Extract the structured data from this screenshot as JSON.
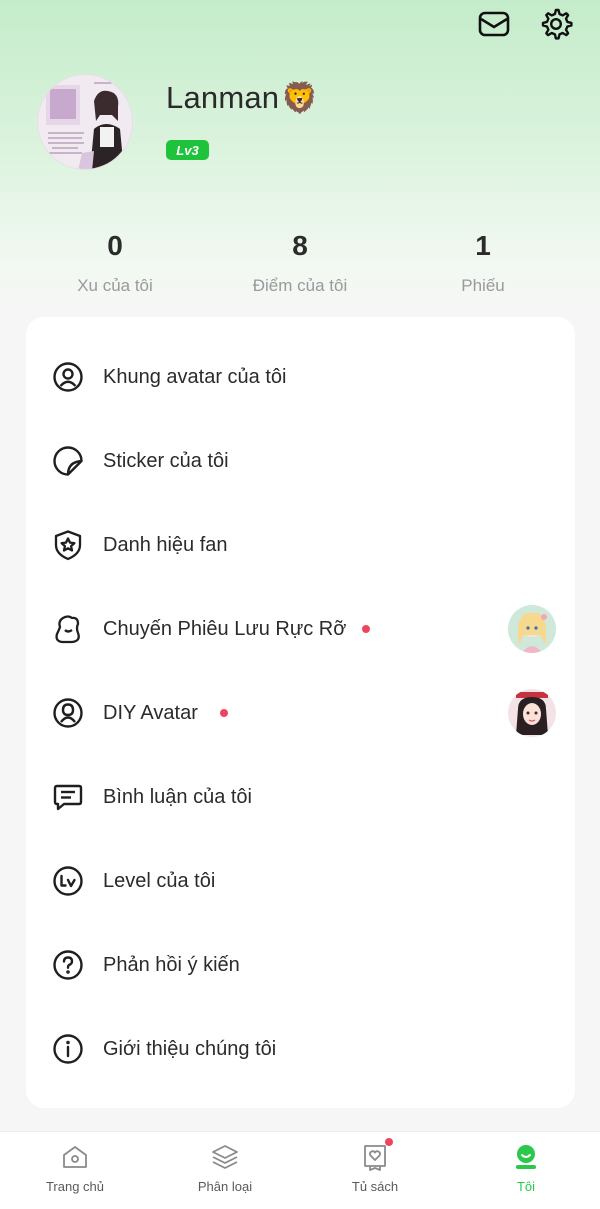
{
  "header": {
    "mail_icon": "mail-icon",
    "settings_icon": "gear-icon"
  },
  "profile": {
    "username": "Lanman",
    "username_emoji": "🦁",
    "level": "Lv3"
  },
  "stats": [
    {
      "value": "0",
      "label": "Xu của tôi"
    },
    {
      "value": "8",
      "label": "Điểm của tôi"
    },
    {
      "value": "1",
      "label": "Phiếu"
    }
  ],
  "menu": {
    "items": [
      {
        "label": "Khung avatar của tôi",
        "icon": "avatar-frame-icon"
      },
      {
        "label": "Sticker của tôi",
        "icon": "sticker-icon"
      },
      {
        "label": "Danh hiệu fan",
        "icon": "shield-star-icon"
      },
      {
        "label": "Chuyến Phiêu Lưu Rực Rỡ",
        "icon": "adventure-icon",
        "has_dot": true
      },
      {
        "label": "DIY Avatar",
        "icon": "diy-avatar-icon",
        "has_dot": true
      },
      {
        "label": "Bình luận của tôi",
        "icon": "comment-icon"
      },
      {
        "label": "Level của tôi",
        "icon": "level-icon"
      },
      {
        "label": "Phản hồi ý kiến",
        "icon": "help-icon"
      },
      {
        "label": "Giới thiệu chúng tôi",
        "icon": "info-icon"
      }
    ]
  },
  "tabbar": {
    "tabs": [
      {
        "label": "Trang chủ",
        "icon": "home-icon"
      },
      {
        "label": "Phân loại",
        "icon": "layers-icon"
      },
      {
        "label": "Tủ sách",
        "icon": "bookshelf-icon",
        "has_dot": true
      },
      {
        "label": "Tôi",
        "icon": "profile-icon",
        "active": true
      }
    ]
  },
  "colors": {
    "accent": "#2cc84c",
    "level_badge": "#1fc33b",
    "notification_dot": "#f0445e",
    "header_gradient_top": "#c4ecca"
  }
}
